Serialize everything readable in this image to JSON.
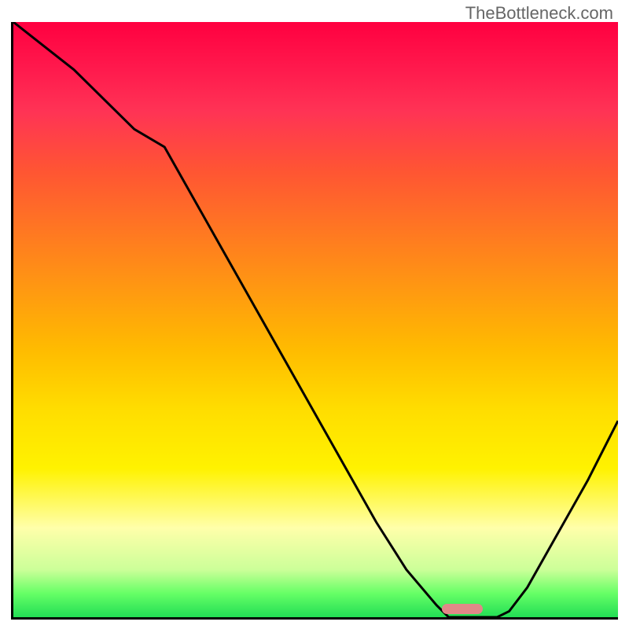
{
  "watermark": "TheBottleneck.com",
  "chart_data": {
    "type": "line",
    "title": "",
    "xlabel": "",
    "ylabel": "",
    "x": [
      0,
      5,
      10,
      15,
      20,
      25,
      30,
      35,
      40,
      45,
      50,
      55,
      60,
      65,
      70,
      72,
      74,
      80,
      82,
      85,
      90,
      95,
      100
    ],
    "values": [
      100,
      96,
      92,
      87,
      82,
      79,
      70,
      61,
      52,
      43,
      34,
      25,
      16,
      8,
      2,
      0,
      0,
      0,
      1,
      5,
      14,
      23,
      33
    ],
    "ylim": [
      0,
      100
    ],
    "xlim": [
      0,
      100
    ],
    "marker": {
      "x": 74,
      "y": 0,
      "color": "#e08888",
      "width": 52,
      "height": 13
    },
    "background": "rainbow-gradient",
    "gradient_stops": [
      {
        "pos": 0,
        "color": "#ff0040"
      },
      {
        "pos": 100,
        "color": "#22dd55"
      }
    ]
  }
}
